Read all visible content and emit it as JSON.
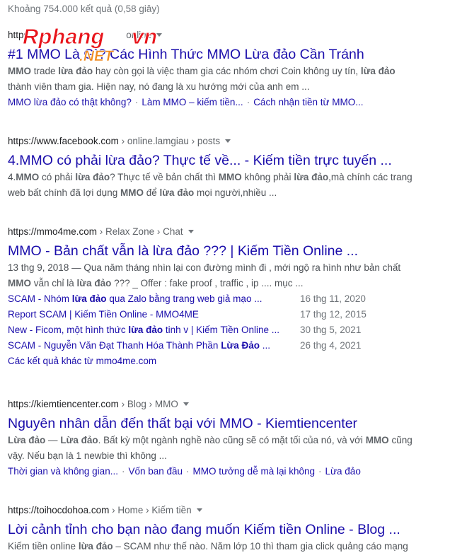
{
  "stats": "Khoảng 754.000 kết quả (0,58 giây)",
  "watermark": {
    "logo_main": "Rphang",
    "logo_vn": "vn",
    "logo_net": ".NET"
  },
  "results": [
    {
      "url_domain": "https",
      "url_path": "online",
      "title": "#1 MMO Là Gì? Các Hình Thức MMO Lừa đảo Cần Tránh",
      "snippet_line1": [
        "MMO",
        " trade ",
        "lừa đảo",
        " hay còn gọi là việc tham gia các nhóm chơi Coin không uy tín, ",
        "lừa đảo"
      ],
      "snippet_line2": "thành viên tham gia. Hiện nay, nó đang là xu hướng mới của anh em ...",
      "sitelinks": [
        "MMO lừa đảo có thật không?",
        "Làm MMO – kiếm tiền...",
        "Cách nhận tiền từ MMO..."
      ]
    },
    {
      "url_domain": "https://www.facebook.com",
      "url_path": " › online.lamgiau › posts",
      "title": "4.MMO có phải lừa đảo? Thực tế về... - Kiếm tiền trực tuyến ...",
      "snippet_line1": [
        "4.",
        "MMO",
        " có phải ",
        "lừa đảo",
        "? Thực tế về bản chất thì ",
        "MMO",
        " không phải ",
        "lừa đảo",
        ",mà chính các trang"
      ],
      "snippet_line2": [
        "web bất chính đã lợi dụng ",
        "MMO",
        " để ",
        "lừa đảo",
        " mọi người,nhiều ..."
      ]
    },
    {
      "url_domain": "https://mmo4me.com",
      "url_path": " › Relax Zone › Chat",
      "title": "MMO - Bản chất vẫn là lừa đảo ??? | Kiếm Tiền Online ...",
      "snippet_line1": "13 thg 9, 2018 — Qua năm tháng nhìn lại con đường mình đi , mới ngộ ra hình như bản chất",
      "snippet_line2": [
        "MMO",
        " vẫn chỉ là ",
        "lừa đảo",
        " ??? _ Offer : fake proof , traffic , ip .... mục ..."
      ],
      "subresults": [
        {
          "pre": "SCAM - Nhóm ",
          "bold": "lừa đảo",
          "post": " qua Zalo bằng trang web giả mạo ...",
          "date": "16 thg 11, 2020"
        },
        {
          "pre": "Report SCAM | Kiếm Tiền Online - MMO4ME",
          "bold": "",
          "post": "",
          "date": "17 thg 12, 2015"
        },
        {
          "pre": "New - Ficom, một hình thức ",
          "bold": "lừa đảo",
          "post": " tinh v | Kiếm Tiền Online ...",
          "date": "30 thg 5, 2021"
        },
        {
          "pre": "SCAM - Nguyễn Văn Đạt Thanh Hóa Thành Phần ",
          "bold": "Lừa Đảo",
          "post": " ...",
          "date": "26 thg 4, 2021"
        }
      ],
      "more": "Các kết quả khác từ mmo4me.com"
    },
    {
      "url_domain": "https://kiemtiencenter.com",
      "url_path": " › Blog › MMO",
      "title": "Nguyên nhân dẫn đến thất bại với MMO - Kiemtiencenter",
      "snippet_line1": [
        "Lừa đảo",
        " — ",
        "Lừa đảo",
        ". Bất kỳ một ngành nghề nào cũng sẽ có mặt tối của nó, và với ",
        "MMO",
        " cũng"
      ],
      "snippet_line2": "vậy. Nếu bạn là 1 newbie thì không ...",
      "sitelinks": [
        "Thời gian và không gian...",
        "Vốn ban đầu",
        "MMO tưởng dễ mà lại không",
        "Lừa đảo"
      ]
    },
    {
      "url_domain": "https://toihocdohoa.com",
      "url_path": " › Home › Kiếm tiền",
      "title": "Lời cảnh tỉnh cho bạn nào đang muốn Kiếm tiền Online - Blog ...",
      "snippet_line1": [
        "Kiếm tiền online ",
        "lừa đảo",
        " – SCAM như thế nào. Năm lớp 10 thì tham gia click quảng cáo mạng"
      ]
    }
  ]
}
